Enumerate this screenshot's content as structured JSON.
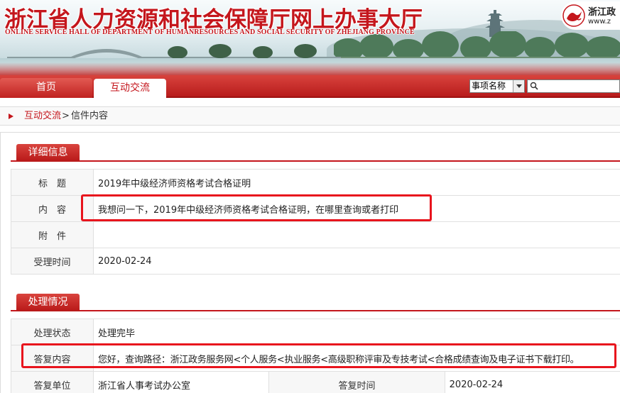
{
  "header": {
    "site_title": "浙江省人力资源和社会保障厅网上办事大厅",
    "site_subtitle": "ONLINE SERVICE HALL OF DEPARTMENT OF HUMANRESOURCES AND SOCIAL SECURITY OF ZHEJIANG PROVINCE",
    "gov_logo_name": "浙江政",
    "gov_logo_url": "www.z"
  },
  "nav": {
    "tabs": [
      {
        "label": "首页",
        "active": false
      },
      {
        "label": "互动交流",
        "active": true
      }
    ],
    "search_select_value": "事项名称",
    "search_placeholder": ""
  },
  "breadcrumb": {
    "link": "互动交流",
    "separator": ">",
    "current": "信件内容"
  },
  "detail": {
    "section_title": "详细信息",
    "rows": [
      {
        "label": "标　题",
        "value": "2019年中级经济师资格考试合格证明"
      },
      {
        "label": "内　容",
        "value": "我想问一下，2019年中级经济师资格考试合格证明，在哪里查询或者打印"
      },
      {
        "label": "附　件",
        "value": ""
      },
      {
        "label": "受理时间",
        "value": "2020-02-24"
      }
    ]
  },
  "handling": {
    "section_title": "处理情况",
    "status_label": "处理状态",
    "status_value": "处理完毕",
    "reply_label": "答复内容",
    "reply_value": "您好，查询路径：浙江政务服务网<个人服务<执业服务<高级职称评审及专技考试<合格成绩查询及电子证书下载打印。",
    "unit_label": "答复单位",
    "unit_value": "浙江省人事考试办公室",
    "time_label": "答复时间",
    "time_value": "2020-02-24"
  },
  "colors": {
    "brand_red": "#c4161c",
    "highlight_red": "#e8141d"
  }
}
